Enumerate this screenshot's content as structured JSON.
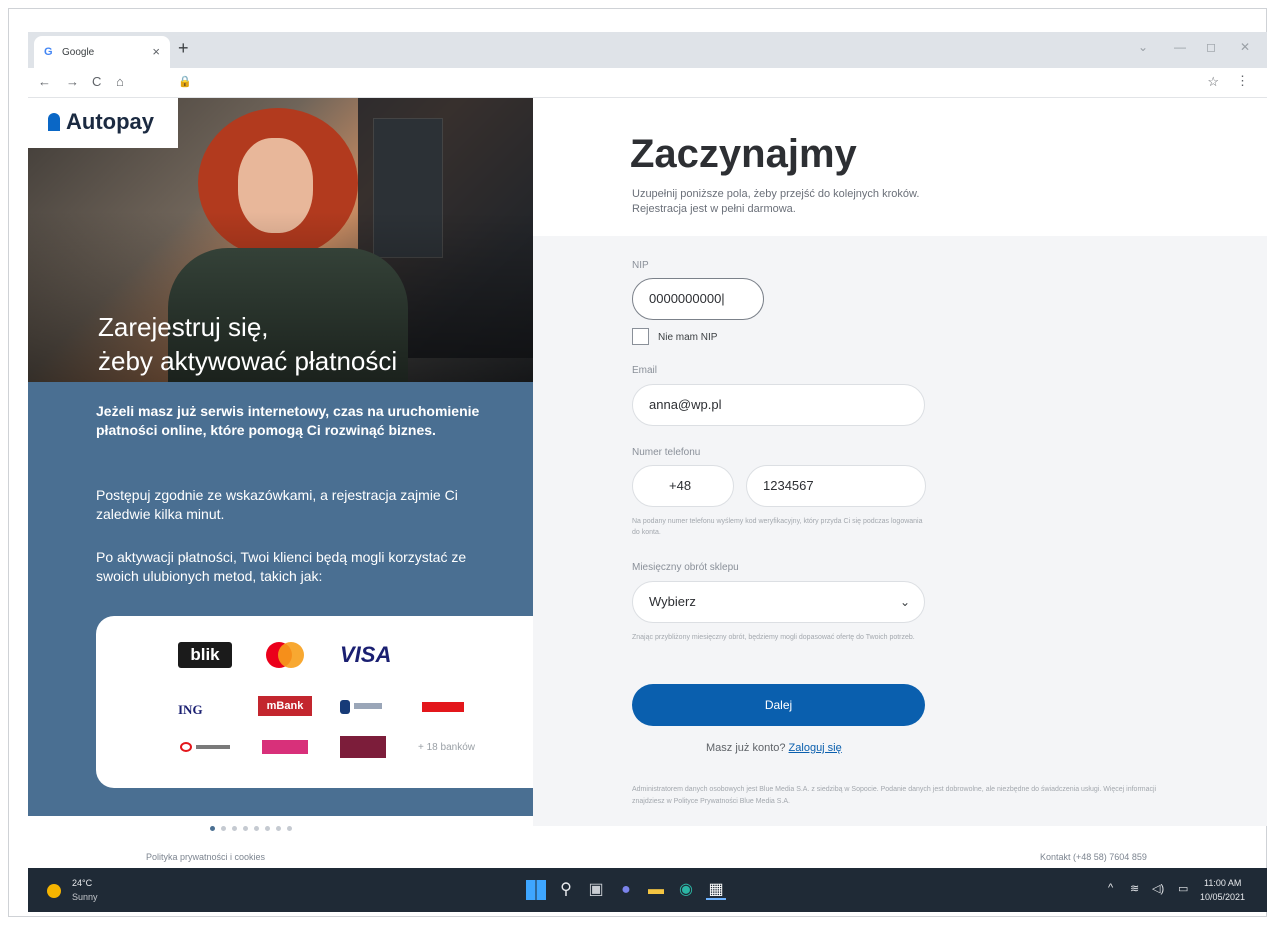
{
  "browser": {
    "tab_title": "Google",
    "tab_favicon": "G",
    "close_tab": "×",
    "new_tab": "+",
    "window_controls": [
      "⌄",
      "—",
      "◻",
      "✕"
    ],
    "nav": [
      "←",
      "→",
      "C",
      "⌂"
    ],
    "lock": "🔒",
    "star": "☆",
    "menu": "⋮"
  },
  "brand": {
    "logo_text": "Autopay",
    "accent": "#0a67c6"
  },
  "hero": {
    "title_line1": "Zarejestruj się,",
    "title_line2": "żeby aktywować płatności"
  },
  "info": {
    "p1": "Jeżeli masz już serwis internetowy, czas na uruchomienie płatności online, które pomogą Ci rozwinąć biznes.",
    "p2": "Postępuj zgodnie ze wskazówkami, a rejestracja zajmie Ci zaledwie kilka minut.",
    "p3": "Po aktywacji płatności, Twoi klienci będą mogli korzystać ze swoich ulubionych metod, takich jak:"
  },
  "payments": {
    "blik": "blik",
    "visa": "VISA",
    "ing": "ING",
    "mbank": "mBank",
    "more_banks": "+ 18 banków"
  },
  "carousel": {
    "count": 8,
    "active": 0
  },
  "form": {
    "heading": "Zaczynajmy",
    "subtitle_line1": "Uzupełnij poniższe pola, żeby przejść do kolejnych kroków.",
    "subtitle_line2": "Rejestracja jest w pełni darmowa.",
    "nip_label": "NIP",
    "nip_value": "0000000000|",
    "no_nip_label": "Nie mam NIP",
    "email_label": "Email",
    "email_value": "anna@wp.pl",
    "phone_label": "Numer telefonu",
    "phone_prefix": "+48",
    "phone_value": "1234567",
    "phone_hint": "Na podany numer telefonu wyślemy kod weryfikacyjny, który przyda Ci się podczas logowania do konta.",
    "turnover_label": "Miesięczny obrót sklepu",
    "turnover_value": "Wybierz",
    "turnover_hint": "Znając przybliżony miesięczny obrót, będziemy mogli dopasować ofertę do Twoich potrzeb.",
    "submit": "Dalej",
    "login_prompt": "Masz już konto?",
    "login_link": "Zaloguj się",
    "admin_note": "Administratorem danych osobowych jest Blue Media S.A. z siedzibą w Sopocie. Podanie danych jest dobrowolne, ale niezbędne do świadczenia usługi. Więcej informacji znajdziesz w Polityce Prywatności Blue Media S.A.",
    "button_color": "#0a5fae"
  },
  "footer": {
    "privacy": "Polityka prywatności i cookies",
    "contact": "Kontakt (+48 58) 7604 859"
  },
  "taskbar": {
    "temperature": "24°C",
    "condition": "Sunny",
    "time": "11:00 AM",
    "date": "10/05/2021",
    "tray_chevron": "^",
    "wifi": "≋",
    "volume": "◁)",
    "battery": "▭"
  }
}
